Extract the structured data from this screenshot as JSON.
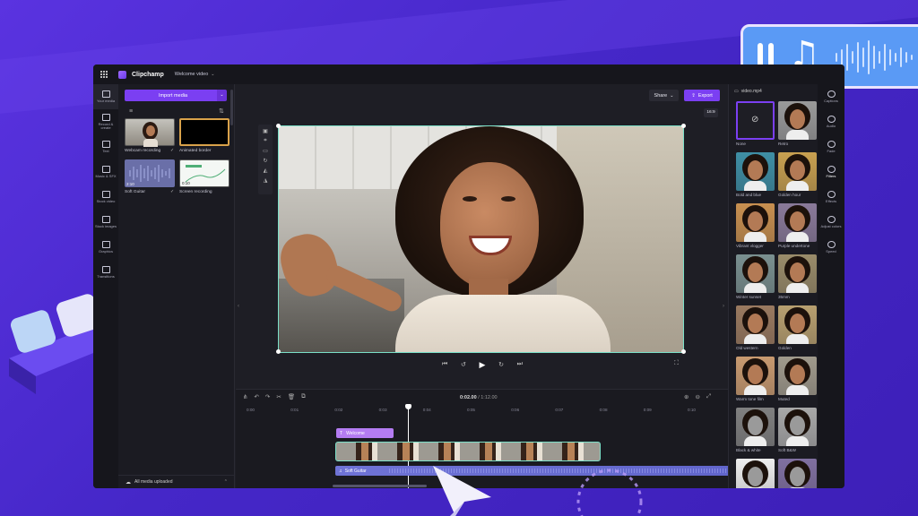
{
  "app": {
    "name": "Clipchamp",
    "project": "Welcome video"
  },
  "rail_left": [
    {
      "label": "Your media",
      "icon": "folder-icon"
    },
    {
      "label": "Record & create",
      "icon": "camera-icon"
    },
    {
      "label": "Text",
      "icon": "text-icon"
    },
    {
      "label": "Music & SFX",
      "icon": "music-icon"
    },
    {
      "label": "Stock video",
      "icon": "film-icon"
    },
    {
      "label": "Stock images",
      "icon": "image-icon"
    },
    {
      "label": "Graphics",
      "icon": "shapes-icon"
    },
    {
      "label": "Transitions",
      "icon": "transition-icon"
    }
  ],
  "media": {
    "import_label": "Import media",
    "items": [
      {
        "label": "Webcam recording"
      },
      {
        "label": "Animated border"
      },
      {
        "label": "Soft Guitar",
        "duration": "2:10"
      },
      {
        "label": "Screen recording",
        "duration": "0:10"
      }
    ],
    "status": "All media uploaded"
  },
  "toolbar": {
    "share": "Share",
    "export": "Export",
    "aspect": "16:9"
  },
  "playback": {
    "time_current": "0:02.00",
    "time_total": "1:12.00"
  },
  "timeline": {
    "ticks": [
      "0:00",
      "0:01",
      "0:02",
      "0:03",
      "0:04",
      "0:05",
      "0:06",
      "0:07",
      "0:08",
      "0:09",
      "0:10"
    ],
    "tick_last": "0:11",
    "text_clip": "Welcome",
    "audio_clip": "Soft Guitar"
  },
  "filters_panel": {
    "header": "video.mp4",
    "items": [
      {
        "label": "None"
      },
      {
        "label": "Retro"
      },
      {
        "label": "Bold and blue"
      },
      {
        "label": "Golden hour"
      },
      {
        "label": "Vibrant vlogger"
      },
      {
        "label": "Purple undertone"
      },
      {
        "label": "Winter sunset"
      },
      {
        "label": "35mm"
      },
      {
        "label": "Old western"
      },
      {
        "label": "Golden"
      },
      {
        "label": "Warm tone film"
      },
      {
        "label": "Muted"
      },
      {
        "label": "Black & white"
      },
      {
        "label": "Soft B&W"
      },
      {
        "label": ""
      },
      {
        "label": ""
      }
    ]
  },
  "rail_right": [
    {
      "label": "Captions",
      "icon": "captions-icon"
    },
    {
      "label": "Audio",
      "icon": "speaker-icon"
    },
    {
      "label": "Fade",
      "icon": "fade-icon"
    },
    {
      "label": "Filters",
      "icon": "filters-icon"
    },
    {
      "label": "Effects",
      "icon": "effects-icon"
    },
    {
      "label": "Adjust colors",
      "icon": "contrast-icon"
    },
    {
      "label": "Speed",
      "icon": "speed-icon"
    }
  ],
  "colors": {
    "accent": "#7b3ff2",
    "background": "#4c2ad6",
    "selection": "#7be0c8"
  }
}
